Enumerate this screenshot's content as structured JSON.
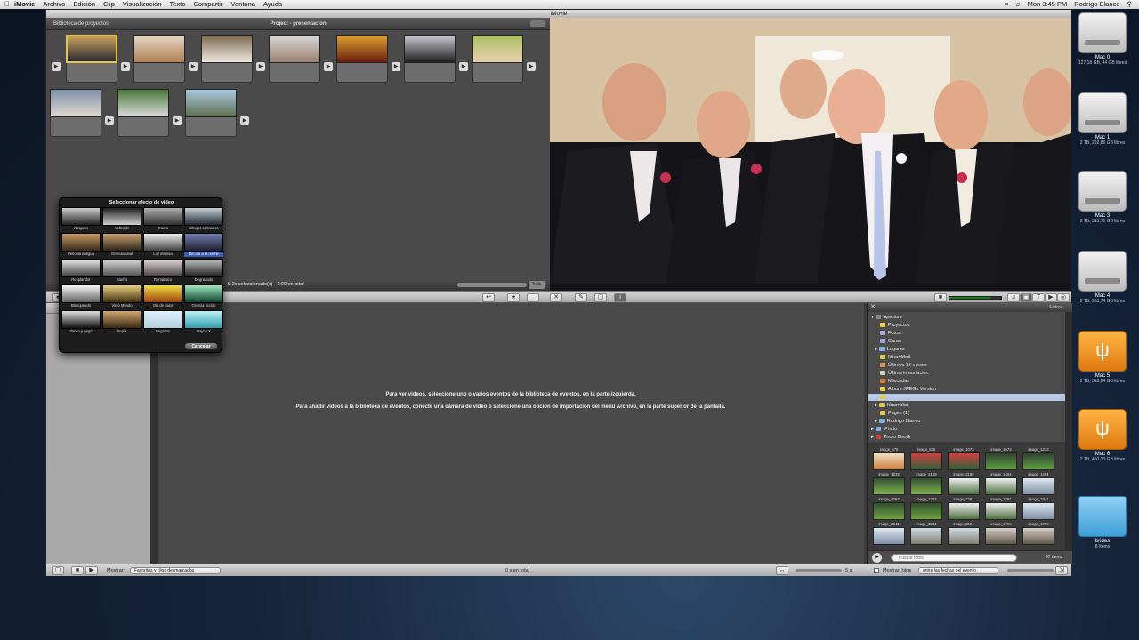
{
  "menubar": {
    "app": "iMovie",
    "menus": [
      "Archivo",
      "Edición",
      "Clip",
      "Visualización",
      "Texto",
      "Compartir",
      "Ventana",
      "Ayuda"
    ],
    "clock": "Mon 3:45 PM",
    "user": "Rodrigo Blanco"
  },
  "window": {
    "title": "iMovie"
  },
  "project": {
    "library_label": "Biblioteca de proyectos",
    "title": "Project - presentacion",
    "status": "5.2s seleccionado(s) - 1:00 en total",
    "all_label": "Todo"
  },
  "effects": {
    "title": "Seleccionar efecto de video",
    "items": [
      "Ninguno",
      "Volteado",
      "Trama",
      "Dibujos animados",
      "Película antigua",
      "Granularidad",
      "Luz intensa",
      "Del día a la noche",
      "Resplandor",
      "Sueño",
      "Romántico",
      "Degradado",
      "Blanqueado",
      "Viejo Mundo",
      "Ola de calor",
      "Ciencia ficción",
      "Blanco y negro",
      "Sepia",
      "Negativo",
      "Rayos X"
    ],
    "selected_index": 7,
    "cancel": "Cancelar"
  },
  "event_browser": {
    "line1": "Para ver videos, seleccione uno o varios eventos de la biblioteca de eventos, en la parte izquierda.",
    "line2": "Para añadir videos a la biblioteca de eventos, conecte una cámara de video o seleccione una opción de importación del menú Archivo, en la parte superior de la pantalla."
  },
  "photos": {
    "header": "Fotos",
    "tree": [
      {
        "label": "Aperture",
        "color": "#888888"
      },
      {
        "label": "Proyectos",
        "color": "#e9c74a"
      },
      {
        "label": "Fotos",
        "color": "#9aa8d8"
      },
      {
        "label": "Caras",
        "color": "#9aa8d8"
      },
      {
        "label": "Lugares",
        "color": "#7fb0e0"
      },
      {
        "label": "Nina+Matt",
        "color": "#e9c74a"
      },
      {
        "label": "Últimos 12 meses",
        "color": "#d0a050"
      },
      {
        "label": "Última importación",
        "color": "#cccccc"
      },
      {
        "label": "Marcadas",
        "color": "#e07a30"
      },
      {
        "label": "Album JPEGs Version",
        "color": "#e9c74a"
      },
      {
        "label": "",
        "color": "#e9c74a"
      },
      {
        "label": "Nina+Matt",
        "color": "#e9c74a"
      },
      {
        "label": "Pages (1)",
        "color": "#e9c74a"
      },
      {
        "label": "Rodrigo Blanco",
        "color": "#7fb0e0"
      },
      {
        "label": "iPhoto",
        "color": "#7fb0e0"
      },
      {
        "label": "Photo Booth",
        "color": "#d04040"
      }
    ],
    "highlight_index": 10,
    "thumbs": [
      "image_670",
      "image_678",
      "image_1073",
      "image_1073",
      "image_1233",
      "image_1233",
      "image_2189",
      "image_2189",
      "image_1484",
      "image_1484",
      "image_2393",
      "image_2393",
      "image_2291",
      "image_2291",
      "image_2341",
      "image_2341",
      "image_2504",
      "image_2504",
      "image_1796",
      "image_1796"
    ],
    "search_placeholder": "Buscar fotos",
    "count": "97 ítems",
    "show_label": "Mostrar fotos",
    "date_filter": "entre las fechas del evento"
  },
  "bottombar": {
    "show_label": "Mostrar:",
    "filter": "Favoritos y clips desmarcados",
    "total": "0 s en total",
    "duration": "5 s"
  },
  "desktop": [
    {
      "name": "Mac 0",
      "info": "127,18 GB, 44 GB libres",
      "kind": "drive"
    },
    {
      "name": "Mac 1",
      "info": "2 TB, 292,86 GB libres",
      "kind": "drive"
    },
    {
      "name": "Mac 3",
      "info": "2 TB, 313,71 GB libres",
      "kind": "drive"
    },
    {
      "name": "Mac 4",
      "info": "2 TB, 963,74 GB libres",
      "kind": "drive"
    },
    {
      "name": "Mac 5",
      "info": "2 TB, 318,94 GB libres",
      "kind": "usb"
    },
    {
      "name": "Mac 6",
      "info": "2 TB, 450,23 GB libres",
      "kind": "usb"
    },
    {
      "name": "brides",
      "info": "8 ítems",
      "kind": "folder"
    }
  ]
}
